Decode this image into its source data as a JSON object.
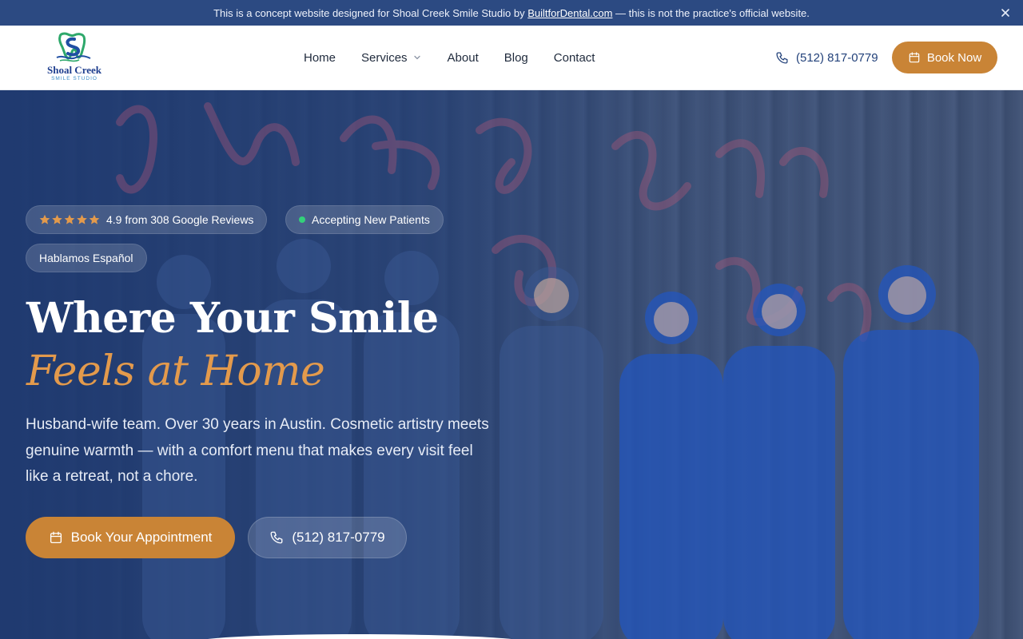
{
  "notice": {
    "prefix": "This is a concept website designed for Shoal Creek Smile Studio by",
    "link": "BuiltforDental.com",
    "suffix": "— this is not the practice's official website."
  },
  "brand": {
    "name": "Shoal Creek",
    "tagline": "SMILE STUDIO"
  },
  "nav": {
    "items": [
      "Home",
      "Services",
      "About",
      "Blog",
      "Contact"
    ]
  },
  "header": {
    "phone": "(512) 817-0779",
    "book_label": "Book Now"
  },
  "hero": {
    "rating": {
      "score_text": "4.9 from 308 Google Reviews",
      "stars": 5
    },
    "badge_patients": "Accepting New Patients",
    "badge_language": "Hablamos Español",
    "headline_line1": "Where Your Smile",
    "headline_line2": "Feels at Home",
    "lead": "Husband-wife team. Over 30 years in Austin. Cosmetic artistry meets genuine warmth — with a comfort menu that makes every visit feel like a retreat, not a chore.",
    "cta_book": "Book Your Appointment",
    "cta_phone": "(512) 817-0779"
  },
  "colors": {
    "primary": "#22417a",
    "accent": "#c98436",
    "headline_accent": "#e39a4c",
    "status_green": "#33d17a"
  },
  "icons": {
    "close": "close-icon",
    "chevron": "chevron-down-icon",
    "phone": "phone-icon",
    "calendar": "calendar-icon",
    "star": "star-icon"
  }
}
